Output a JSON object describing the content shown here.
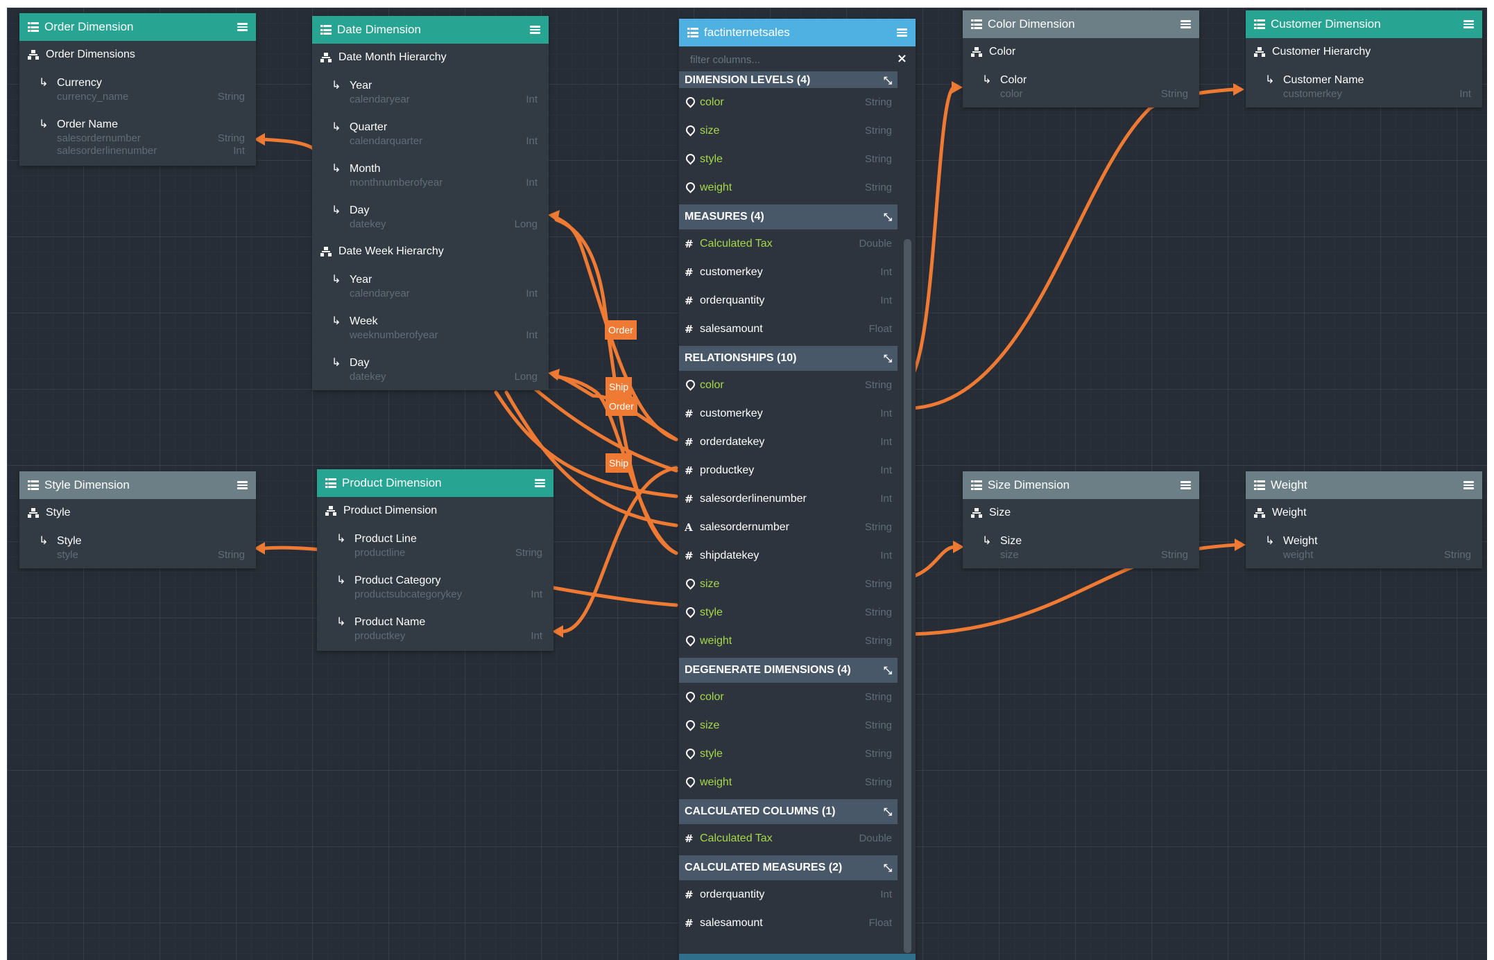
{
  "fact_table": {
    "title": "factinternetsales",
    "filter_placeholder": "filter columns...",
    "sections": [
      {
        "title": "DIMENSION LEVELS (4)",
        "rows": [
          {
            "icon": "pin",
            "name": "color",
            "type": "String",
            "highlight": true
          },
          {
            "icon": "pin",
            "name": "size",
            "type": "String",
            "highlight": true
          },
          {
            "icon": "pin",
            "name": "style",
            "type": "String",
            "highlight": true
          },
          {
            "icon": "pin",
            "name": "weight",
            "type": "String",
            "highlight": true
          }
        ]
      },
      {
        "title": "MEASURES (4)",
        "rows": [
          {
            "icon": "hash",
            "name": "Calculated Tax",
            "type": "Double",
            "highlight": true
          },
          {
            "icon": "hash",
            "name": "customerkey",
            "type": "Int",
            "highlight": false
          },
          {
            "icon": "hash",
            "name": "orderquantity",
            "type": "Int",
            "highlight": false
          },
          {
            "icon": "hash",
            "name": "salesamount",
            "type": "Float",
            "highlight": false
          }
        ]
      },
      {
        "title": "RELATIONSHIPS (10)",
        "rows": [
          {
            "icon": "pin",
            "name": "color",
            "type": "String",
            "highlight": true
          },
          {
            "icon": "hash",
            "name": "customerkey",
            "type": "Int",
            "highlight": false
          },
          {
            "icon": "hash",
            "name": "orderdatekey",
            "type": "Int",
            "highlight": false
          },
          {
            "icon": "hash",
            "name": "productkey",
            "type": "Int",
            "highlight": false
          },
          {
            "icon": "hash",
            "name": "salesorderlinenumber",
            "type": "Int",
            "highlight": false
          },
          {
            "icon": "text",
            "name": "salesordernumber",
            "type": "String",
            "highlight": false
          },
          {
            "icon": "hash",
            "name": "shipdatekey",
            "type": "Int",
            "highlight": false
          },
          {
            "icon": "pin",
            "name": "size",
            "type": "String",
            "highlight": true
          },
          {
            "icon": "pin",
            "name": "style",
            "type": "String",
            "highlight": true
          },
          {
            "icon": "pin",
            "name": "weight",
            "type": "String",
            "highlight": true
          }
        ]
      },
      {
        "title": "DEGENERATE DIMENSIONS (4)",
        "rows": [
          {
            "icon": "pin",
            "name": "color",
            "type": "String",
            "highlight": true
          },
          {
            "icon": "pin",
            "name": "size",
            "type": "String",
            "highlight": true
          },
          {
            "icon": "pin",
            "name": "style",
            "type": "String",
            "highlight": true
          },
          {
            "icon": "pin",
            "name": "weight",
            "type": "String",
            "highlight": true
          }
        ]
      },
      {
        "title": "CALCULATED COLUMNS (1)",
        "rows": [
          {
            "icon": "hash",
            "name": "Calculated Tax",
            "type": "Double",
            "highlight": true
          }
        ]
      },
      {
        "title": "CALCULATED MEASURES (2)",
        "rows": [
          {
            "icon": "hash",
            "name": "orderquantity",
            "type": "Int",
            "highlight": false
          },
          {
            "icon": "hash",
            "name": "salesamount",
            "type": "Float",
            "highlight": false
          }
        ]
      }
    ]
  },
  "dimensions": {
    "order": {
      "title": "Order Dimension",
      "hierarchies": [
        {
          "name": "Order Dimensions",
          "levels": [
            {
              "name": "Currency",
              "columns": [
                "currency_name"
              ],
              "types": [
                "String"
              ]
            },
            {
              "name": "Order Name",
              "columns": [
                "salesordernumber",
                "salesorderlinenumber"
              ],
              "types": [
                "String",
                "Int"
              ]
            }
          ]
        }
      ]
    },
    "date": {
      "title": "Date Dimension",
      "hierarchies": [
        {
          "name": "Date Month Hierarchy",
          "levels": [
            {
              "name": "Year",
              "columns": [
                "calendaryear"
              ],
              "types": [
                "Int"
              ]
            },
            {
              "name": "Quarter",
              "columns": [
                "calendarquarter"
              ],
              "types": [
                "Int"
              ]
            },
            {
              "name": "Month",
              "columns": [
                "monthnumberofyear"
              ],
              "types": [
                "Int"
              ]
            },
            {
              "name": "Day",
              "columns": [
                "datekey"
              ],
              "types": [
                "Long"
              ]
            }
          ]
        },
        {
          "name": "Date Week Hierarchy",
          "levels": [
            {
              "name": "Year",
              "columns": [
                "calendaryear"
              ],
              "types": [
                "Int"
              ]
            },
            {
              "name": "Week",
              "columns": [
                "weeknumberofyear"
              ],
              "types": [
                "Int"
              ]
            },
            {
              "name": "Day",
              "columns": [
                "datekey"
              ],
              "types": [
                "Long"
              ]
            }
          ]
        }
      ]
    },
    "style": {
      "title": "Style Dimension",
      "hierarchies": [
        {
          "name": "Style",
          "levels": [
            {
              "name": "Style",
              "columns": [
                "style"
              ],
              "types": [
                "String"
              ]
            }
          ]
        }
      ]
    },
    "product": {
      "title": "Product Dimension",
      "hierarchies": [
        {
          "name": "Product Dimension",
          "levels": [
            {
              "name": "Product Line",
              "columns": [
                "productline"
              ],
              "types": [
                "String"
              ]
            },
            {
              "name": "Product Category",
              "columns": [
                "productsubcategorykey"
              ],
              "types": [
                "Int"
              ]
            },
            {
              "name": "Product Name",
              "columns": [
                "productkey"
              ],
              "types": [
                "Int"
              ]
            }
          ]
        }
      ]
    },
    "color": {
      "title": "Color Dimension",
      "hierarchies": [
        {
          "name": "Color",
          "levels": [
            {
              "name": "Color",
              "columns": [
                "color"
              ],
              "types": [
                "String"
              ]
            }
          ]
        }
      ]
    },
    "customer": {
      "title": "Customer Dimension",
      "hierarchies": [
        {
          "name": "Customer Hierarchy",
          "levels": [
            {
              "name": "Customer Name",
              "columns": [
                "customerkey"
              ],
              "types": [
                "Int"
              ]
            }
          ]
        }
      ]
    },
    "size": {
      "title": "Size Dimension",
      "hierarchies": [
        {
          "name": "Size",
          "levels": [
            {
              "name": "Size",
              "columns": [
                "size"
              ],
              "types": [
                "String"
              ]
            }
          ]
        }
      ]
    },
    "weight": {
      "title": "Weight",
      "hierarchies": [
        {
          "name": "Weight",
          "levels": [
            {
              "name": "Weight",
              "columns": [
                "weight"
              ],
              "types": [
                "String"
              ]
            }
          ]
        }
      ]
    }
  },
  "link_labels": [
    "Order",
    "Ship",
    "Order",
    "Ship"
  ],
  "colors": {
    "canvas": "#272d36",
    "card": "#323a44",
    "header_teal": "#27a592",
    "header_gray": "#6d7f86",
    "header_blue": "#4fb0e2",
    "section": "#495868",
    "link": "#ee7a33",
    "highlight_text": "#a5d84a",
    "muted_text": "#5f6d78"
  }
}
